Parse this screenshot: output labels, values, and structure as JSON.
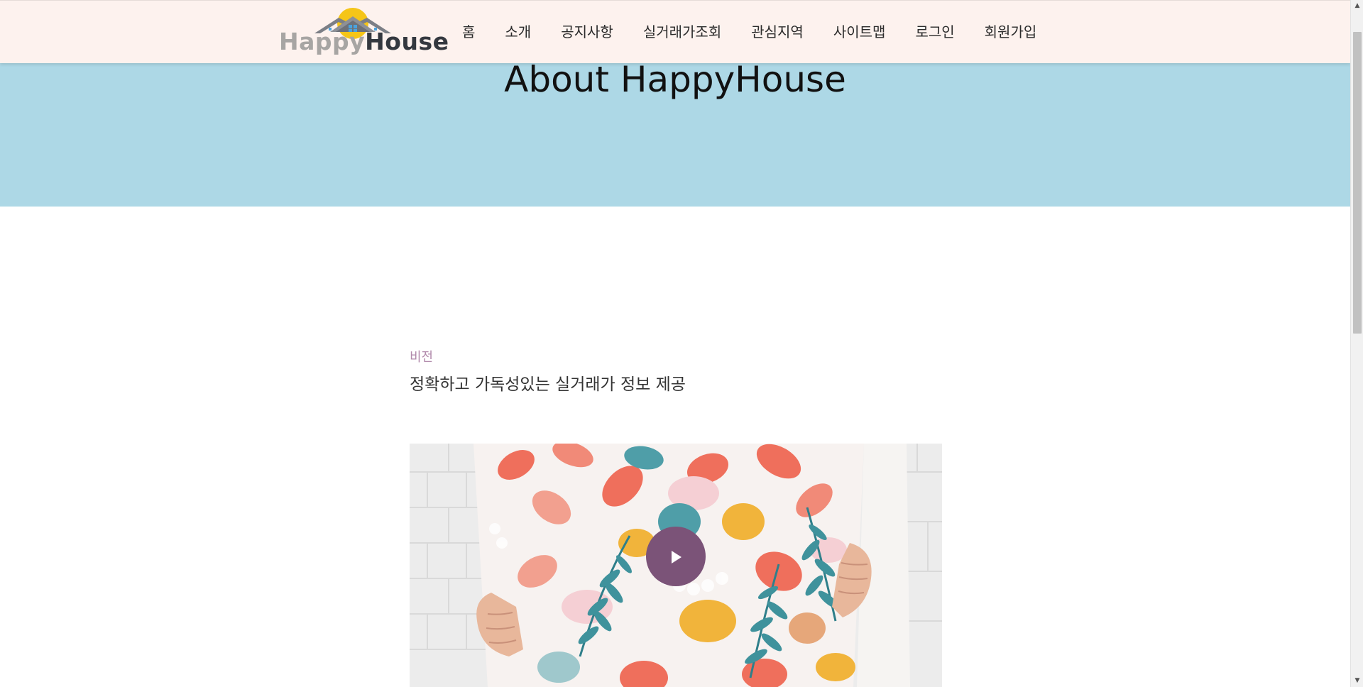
{
  "header": {
    "logo": {
      "happy": "Happy",
      "house": "House"
    },
    "nav": [
      {
        "label": "홈"
      },
      {
        "label": "소개"
      },
      {
        "label": "공지사항"
      },
      {
        "label": "실거래가조회"
      },
      {
        "label": "관심지역"
      },
      {
        "label": "사이트맵"
      },
      {
        "label": "로그인"
      },
      {
        "label": "회원가입"
      }
    ]
  },
  "hero": {
    "title": "About HappyHouse",
    "background": "#add8e6"
  },
  "section": {
    "label": "비전",
    "heading": "정확하고 가독성있는 실거래가 정보 제공"
  },
  "video": {
    "play_icon": "play-icon",
    "button_color": "#7b5378"
  },
  "colors": {
    "header_bg": "#fdf2ee",
    "label_color": "#b28bac",
    "accent_sun": "#f5c518"
  }
}
